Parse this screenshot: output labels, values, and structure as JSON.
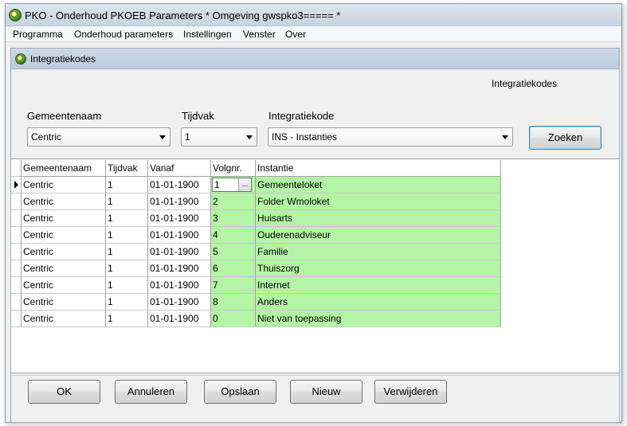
{
  "window": {
    "title": "PKO - Onderhoud PKOEB Parameters * Omgeving gwspko3===== *"
  },
  "menu": [
    "Programma",
    "Onderhoud parameters",
    "Instellingen",
    "Venster",
    "Over"
  ],
  "child_window": {
    "title": "Integratiekodes",
    "heading": "Integratiekodes"
  },
  "filters": {
    "gemeentenaam_label": "Gemeentenaam",
    "gemeentenaam_value": "Centric",
    "tijdvak_label": "Tijdvak",
    "tijdvak_value": "1",
    "integratiekode_label": "Integratiekode",
    "integratiekode_value": "INS - Instanties",
    "search_button": "Zoeken"
  },
  "grid": {
    "columns": [
      "Gemeentenaam",
      "Tijdvak",
      "Vanaf",
      "Volgnr.",
      "Instantie"
    ],
    "rows": [
      [
        "Centric",
        "1",
        "01-01-1900",
        "1",
        "Gemeenteloket"
      ],
      [
        "Centric",
        "1",
        "01-01-1900",
        "2",
        "Folder Wmoloket"
      ],
      [
        "Centric",
        "1",
        "01-01-1900",
        "3",
        "Huisarts"
      ],
      [
        "Centric",
        "1",
        "01-01-1900",
        "4",
        "Ouderenadviseur"
      ],
      [
        "Centric",
        "1",
        "01-01-1900",
        "5",
        "Familie"
      ],
      [
        "Centric",
        "1",
        "01-01-1900",
        "6",
        "Thuiszorg"
      ],
      [
        "Centric",
        "1",
        "01-01-1900",
        "7",
        "Internet"
      ],
      [
        "Centric",
        "1",
        "01-01-1900",
        "8",
        "Anders"
      ],
      [
        "Centric",
        "1",
        "01-01-1900",
        "0",
        "Niet van toepassing"
      ]
    ],
    "ellipsis": "..."
  },
  "buttons": {
    "ok": "OK",
    "annuleren": "Annuleren",
    "opslaan": "Opslaan",
    "nieuw": "Nieuw",
    "verwijderen": "Verwijderen"
  },
  "colors": {
    "editable_cell": "#b3f5a4"
  }
}
